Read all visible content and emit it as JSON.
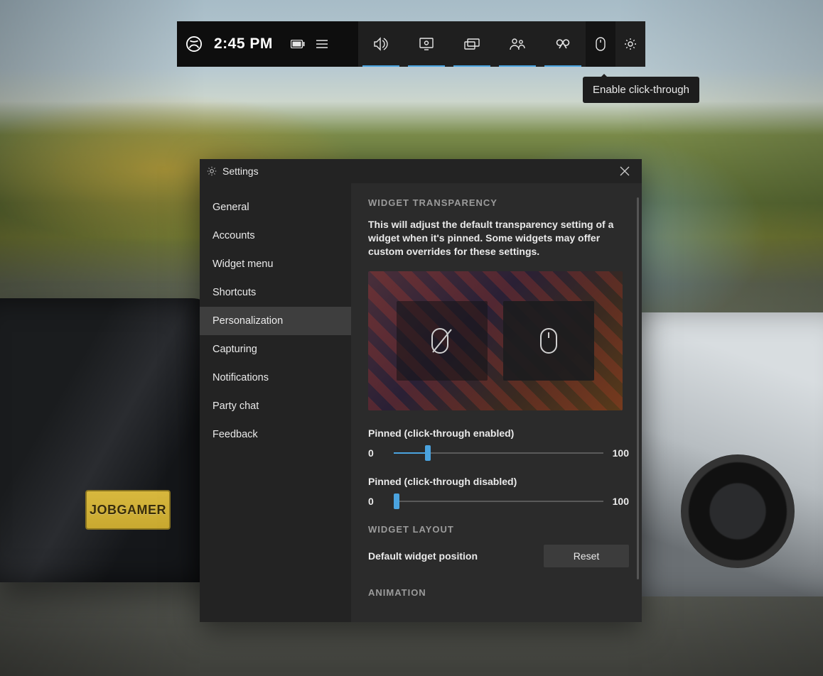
{
  "topbar": {
    "time": "2:45 PM",
    "tooltip": "Enable click-through"
  },
  "license_plate": "JOBGAMER",
  "settings": {
    "title": "Settings",
    "sidebar": [
      "General",
      "Accounts",
      "Widget menu",
      "Shortcuts",
      "Personalization",
      "Capturing",
      "Notifications",
      "Party chat",
      "Feedback"
    ],
    "selected_index": 4,
    "sections": {
      "transparency": {
        "heading": "WIDGET TRANSPARENCY",
        "description": "This will adjust the default transparency setting of a widget when it's pinned. Some widgets may offer custom overrides for these settings.",
        "slider1_label": "Pinned (click-through enabled)",
        "slider1_min": "0",
        "slider1_max": "100",
        "slider1_value": 15,
        "slider2_label": "Pinned (click-through disabled)",
        "slider2_min": "0",
        "slider2_max": "100",
        "slider2_value": 0
      },
      "layout": {
        "heading": "WIDGET LAYOUT",
        "position_label": "Default widget position",
        "reset_label": "Reset"
      },
      "animation": {
        "heading": "ANIMATION"
      }
    }
  }
}
